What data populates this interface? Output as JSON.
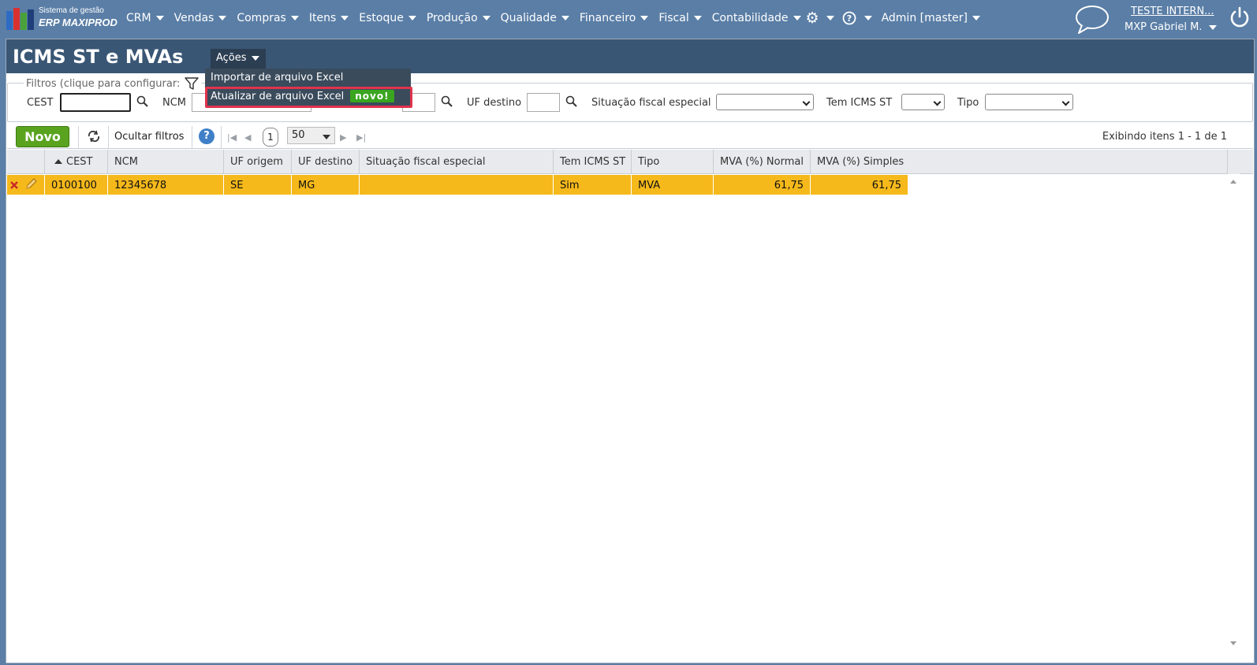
{
  "app": {
    "logo_line1": "Sistema de gestão",
    "logo_line2": "ERP MAXIPROD"
  },
  "nav": {
    "items": [
      {
        "label": "CRM"
      },
      {
        "label": "Vendas"
      },
      {
        "label": "Compras"
      },
      {
        "label": "Itens"
      },
      {
        "label": "Estoque"
      },
      {
        "label": "Produção"
      },
      {
        "label": "Qualidade"
      },
      {
        "label": "Financeiro"
      },
      {
        "label": "Fiscal"
      },
      {
        "label": "Contabilidade"
      }
    ],
    "admin_label": "Admin [master]",
    "company_link": "TESTE INTERN...",
    "user_name": "MXP Gabriel M."
  },
  "page": {
    "title": "ICMS ST e MVAs",
    "actions_label": "Ações"
  },
  "actions_menu": {
    "items": [
      {
        "label": "Importar de arquivo Excel"
      },
      {
        "label": "Atualizar de arquivo Excel",
        "badge": "novo!"
      }
    ]
  },
  "filters": {
    "legend": "Filtros (clique para configurar:",
    "cest_label": "CEST",
    "cest_value": "",
    "ncm_label": "NCM",
    "ncm_value": "",
    "uf_origem_value": "",
    "uf_destino_label": "UF destino",
    "uf_destino_value": "",
    "situacao_label": "Situação fiscal especial",
    "situacao_value": "",
    "tem_icms_label": "Tem ICMS ST",
    "tem_icms_value": "",
    "tipo_label": "Tipo",
    "tipo_value": ""
  },
  "toolbar": {
    "novo_label": "Novo",
    "hide_filters_label": "Ocultar filtros",
    "help_label": "?",
    "page_number": "1",
    "page_size": "50",
    "items_info": "Exibindo itens 1 - 1 de 1"
  },
  "grid": {
    "columns": [
      "CEST",
      "NCM",
      "UF origem",
      "UF destino",
      "Situação fiscal especial",
      "Tem ICMS ST",
      "Tipo",
      "MVA (%) Normal",
      "MVA (%) Simples"
    ],
    "rows": [
      {
        "cest": "0100100",
        "ncm": "12345678",
        "uf_origem": "SE",
        "uf_destino": "MG",
        "situacao": "",
        "tem_icms_st": "Sim",
        "tipo": "MVA",
        "mva_normal": "61,75",
        "mva_simples": "61,75"
      }
    ]
  },
  "colors": {
    "nav_bg": "#5a7ea6",
    "title_bar": "#3a5675",
    "row_highlight": "#f5b91b",
    "novo_button": "#5aa31f",
    "new_badge": "#3aa51f",
    "highlight_border": "#e0334c"
  }
}
